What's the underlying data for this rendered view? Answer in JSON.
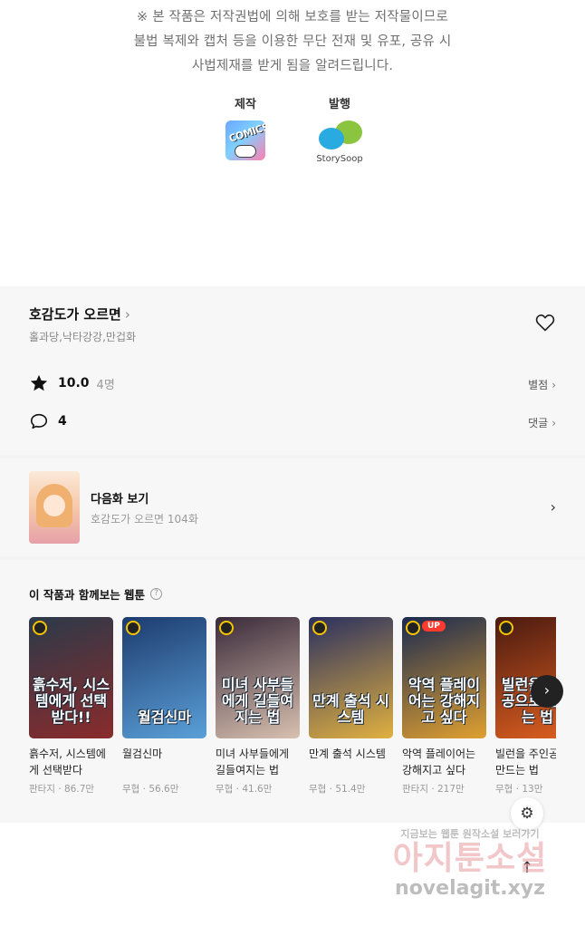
{
  "notice": {
    "line1": "※ 본 작품은 저작권법에 의해 보호를 받는 저작물이므로",
    "line2": "불법 복제와 캡처 등을 이용한 무단 전재 및 유포, 공유 시",
    "line3": "사법제재를 받게 됨을 알려드립니다."
  },
  "credits": {
    "production_label": "제작",
    "production_logo_text": "COMICS",
    "publisher_label": "발행",
    "publisher_name": "StorySoop"
  },
  "series": {
    "title": "호감도가 오르면",
    "authors": "홀과당,낙타강강,만겁화",
    "rating": "10.0",
    "rating_count": "4명",
    "rating_link": "별점",
    "comment_count": "4",
    "comment_link": "댓글"
  },
  "next_episode": {
    "label": "다음화 보기",
    "subtitle": "호감도가 오르면 104화"
  },
  "recommendations": {
    "heading": "이 작품과 함께보는 웹툰",
    "help_icon": "?",
    "items": [
      {
        "title": "흙수저, 시스템에게 선택받다",
        "meta": "판타지 · 86.7만",
        "art_text": "흙수저, 시스템에게 선택받다!!",
        "colors": [
          "#2b3a4a",
          "#8a2b2b"
        ],
        "badge_up": false
      },
      {
        "title": "월검신마",
        "meta": "무협 · 56.6만",
        "art_text": "월검신마",
        "colors": [
          "#1d3b6e",
          "#5aa0d8"
        ],
        "badge_up": false
      },
      {
        "title": "미녀 사부들에게 길들여지는 법",
        "meta": "무협 · 41.6만",
        "art_text": "미녀 사부들에게 길들여지는 법",
        "colors": [
          "#3a2a3a",
          "#d8c0b0"
        ],
        "badge_up": false
      },
      {
        "title": "만계 출석 시스템",
        "meta": "무협 · 51.4만",
        "art_text": "만계 출석 시스템",
        "colors": [
          "#2a3060",
          "#e0b040"
        ],
        "badge_up": false
      },
      {
        "title": "악역 플레이어는 강해지고 싶다",
        "meta": "판타지 · 217만",
        "art_text": "악역 플레이어는 강해지고 싶다",
        "colors": [
          "#1a2a50",
          "#e0a030"
        ],
        "badge_up": true
      },
      {
        "title": "빌런을 주인공으로 만드는 법",
        "meta": "무협 · 13만",
        "art_text": "빌런을 주인공으로 만드는 법",
        "colors": [
          "#4a1a10",
          "#e06020"
        ],
        "badge_up": false
      }
    ]
  },
  "watermark": {
    "line1": "지금보는 웹툰 원작소설 보러가기",
    "line2": "아지툰소설",
    "line3": "novelagit.xyz"
  },
  "icons": {
    "heart": "heart-icon",
    "star": "star-icon",
    "comment": "comment-icon",
    "settings": "gear-icon",
    "scroll_top": "arrow-up-icon"
  }
}
